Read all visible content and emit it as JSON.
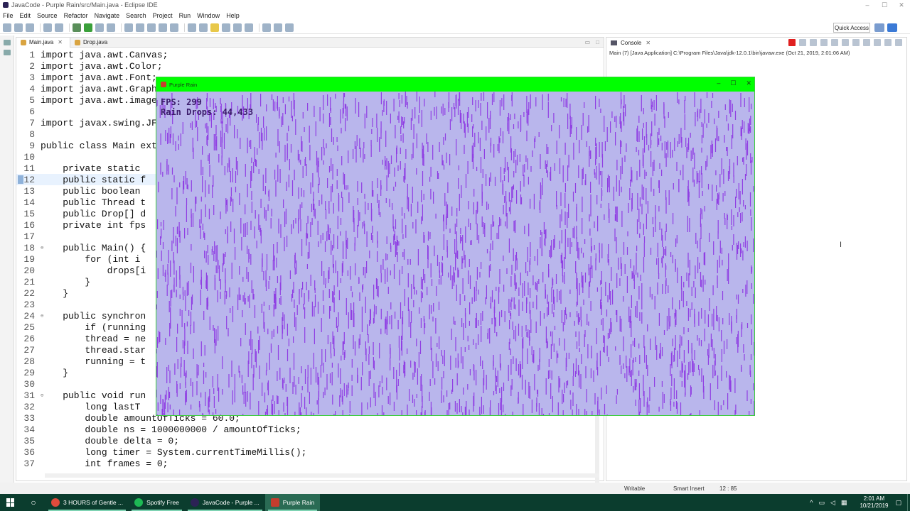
{
  "window": {
    "title": "JavaCode - Purple Rain/src/Main.java - Eclipse IDE",
    "controls": [
      "–",
      "☐",
      "✕"
    ]
  },
  "menu": [
    "File",
    "Edit",
    "Source",
    "Refactor",
    "Navigate",
    "Search",
    "Project",
    "Run",
    "Window",
    "Help"
  ],
  "toolbar": {
    "quick_access": "Quick Access"
  },
  "editor": {
    "tabs": [
      {
        "label": "Main.java",
        "active": true
      },
      {
        "label": "Drop.java",
        "active": false
      }
    ],
    "lines": [
      {
        "n": "1",
        "text": "import java.awt.Canvas;"
      },
      {
        "n": "2",
        "text": "import java.awt.Color;"
      },
      {
        "n": "3",
        "text": "import java.awt.Font;"
      },
      {
        "n": "4",
        "text": "import java.awt.Graphics;"
      },
      {
        "n": "5",
        "text": "import java.awt.image.BufferStrategy;"
      },
      {
        "n": "6",
        "text": ""
      },
      {
        "n": "7",
        "text": "import javax.swing.JFrame;"
      },
      {
        "n": "8",
        "text": ""
      },
      {
        "n": "9",
        "text": "public class Main extends Canvas implements Runnable {"
      },
      {
        "n": "10",
        "text": ""
      },
      {
        "n": "11",
        "text": "    private static"
      },
      {
        "n": "12",
        "text": "    public static f"
      },
      {
        "n": "13",
        "text": "    public boolean"
      },
      {
        "n": "14",
        "text": "    public Thread t"
      },
      {
        "n": "15",
        "text": "    public Drop[] d"
      },
      {
        "n": "16",
        "text": "    private int fps"
      },
      {
        "n": "17",
        "text": ""
      },
      {
        "n": "18",
        "text": "    public Main() {"
      },
      {
        "n": "19",
        "text": "        for (int i"
      },
      {
        "n": "20",
        "text": "            drops[i"
      },
      {
        "n": "21",
        "text": "        }"
      },
      {
        "n": "22",
        "text": "    }"
      },
      {
        "n": "23",
        "text": ""
      },
      {
        "n": "24",
        "text": "    public synchron"
      },
      {
        "n": "25",
        "text": "        if (running"
      },
      {
        "n": "26",
        "text": "        thread = ne"
      },
      {
        "n": "27",
        "text": "        thread.star"
      },
      {
        "n": "28",
        "text": "        running = t"
      },
      {
        "n": "29",
        "text": "    }"
      },
      {
        "n": "30",
        "text": ""
      },
      {
        "n": "31",
        "text": "    public void run"
      },
      {
        "n": "32",
        "text": "        long lastT"
      },
      {
        "n": "33",
        "text": "        double amountOfTicks = 60.0;"
      },
      {
        "n": "34",
        "text": "        double ns = 1000000000 / amountOfTicks;"
      },
      {
        "n": "35",
        "text": "        double delta = 0;"
      },
      {
        "n": "36",
        "text": "        long timer = System.currentTimeMillis();"
      },
      {
        "n": "37",
        "text": "        int frames = 0;"
      }
    ]
  },
  "console": {
    "tab_label": "Console",
    "launch": "Main (7) [Java Application] C:\\Program Files\\Java\\jdk-12.0.1\\bin\\javaw.exe (Oct 21, 2019, 2:01:06 AM)"
  },
  "status": {
    "writable": "Writable",
    "insert_mode": "Smart Insert",
    "position": "12 : 85"
  },
  "rain_window": {
    "title": "Purple Rain",
    "fps": "FPS: 299",
    "drops": "Rain Drops: 44,433",
    "colors": {
      "frame": "#00ff00",
      "background": "#b9b6ec",
      "drop": "#8a2be2"
    }
  },
  "taskbar": {
    "items": [
      {
        "label": "3 HOURS of Gentle ...",
        "icon": "chrome-icon",
        "color": "#e04b3c"
      },
      {
        "label": "Spotify Free",
        "icon": "spotify-icon",
        "color": "#1db954"
      },
      {
        "label": "JavaCode - Purple ...",
        "icon": "eclipse-icon",
        "color": "#2c2255"
      },
      {
        "label": "Purple Rain",
        "icon": "java-icon",
        "color": "#c43d2e",
        "active": true
      }
    ],
    "time": "2:01 AM",
    "date": "10/21/2019"
  }
}
